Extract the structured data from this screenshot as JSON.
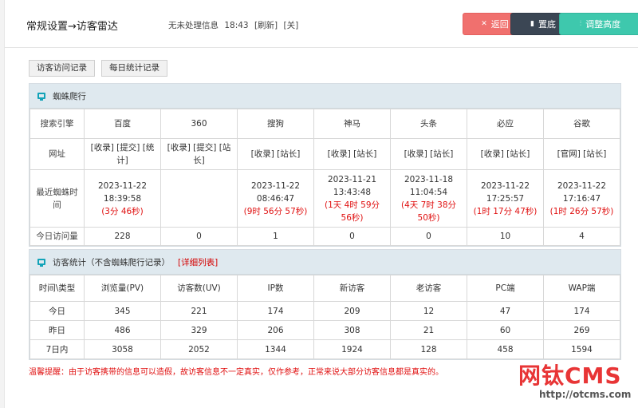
{
  "header": {
    "title": "常规设置→访客雷达",
    "unread_label": "无未处理信息",
    "time": "18:43",
    "refresh_link": "[刷新]",
    "close_link": "[关]"
  },
  "buttons": {
    "back_label": "返回",
    "top_label": "置底",
    "height_label": "调整高度"
  },
  "tabs": [
    "访客访问记录",
    "每日统计记录"
  ],
  "spider": {
    "title": "蜘蛛爬行",
    "row_labels": {
      "engine": "搜索引擎",
      "url": "网址",
      "last_crawl": "最近蜘蛛时间",
      "today": "今日访问量"
    },
    "engines": [
      {
        "name": "百度",
        "links": "[收录] [提交] [统计]",
        "date": "2023-11-22",
        "time": "18:39:58",
        "ago": "(3分 46秒)",
        "today": "228"
      },
      {
        "name": "360",
        "links": "[收录] [提交] [站长]",
        "date": "",
        "time": "",
        "ago": "",
        "today": "0"
      },
      {
        "name": "搜狗",
        "links": "[收录] [站长]",
        "date": "2023-11-22",
        "time": "08:46:47",
        "ago": "(9时 56分 57秒)",
        "today": "1"
      },
      {
        "name": "神马",
        "links": "[收录] [站长]",
        "date": "2023-11-21",
        "time": "13:43:48",
        "ago": "(1天 4时 59分 56秒)",
        "today": "0"
      },
      {
        "name": "头条",
        "links": "[收录] [站长]",
        "date": "2023-11-18",
        "time": "11:04:54",
        "ago": "(4天 7时 38分 50秒)",
        "today": "0"
      },
      {
        "name": "必应",
        "links": "[收录] [站长]",
        "date": "2023-11-22",
        "time": "17:25:57",
        "ago": "(1时 17分 47秒)",
        "today": "10"
      },
      {
        "name": "谷歌",
        "links": "[官网] [站长]",
        "date": "2023-11-22",
        "time": "17:16:47",
        "ago": "(1时 26分 57秒)",
        "today": "4"
      }
    ]
  },
  "visitors": {
    "title": "访客统计（不含蜘蛛爬行记录）",
    "detail_link": "[详细列表]",
    "columns": [
      "时间\\类型",
      "浏览量(PV)",
      "访客数(UV)",
      "IP数",
      "新访客",
      "老访客",
      "PC端",
      "WAP端"
    ],
    "rows": [
      [
        "今日",
        "345",
        "221",
        "174",
        "209",
        "12",
        "47",
        "174"
      ],
      [
        "昨日",
        "486",
        "329",
        "206",
        "308",
        "21",
        "60",
        "269"
      ],
      [
        "7日内",
        "3058",
        "2052",
        "1344",
        "1924",
        "128",
        "458",
        "1594"
      ]
    ]
  },
  "notice": "温馨提醒：由于访客携带的信息可以造假，故访客信息不一定真实，仅作参考，正常来说大部分访客信息都是真实的。",
  "watermark": {
    "logo": "网钛CMS",
    "url": "http://otcms.com"
  },
  "colors": {
    "back_button": "#f0706e",
    "top_button": "#3b4654",
    "height_button": "#3ec8ad",
    "panel_header": "#dfe9ef",
    "alert_red": "#e01010",
    "logo_red": "#e83536",
    "monitor_icon": "#12a3b8"
  },
  "icons": {
    "back": "x-mark-icon",
    "top": "bookmark-icon",
    "height": "sliders-icon",
    "panel": "monitor-icon"
  }
}
